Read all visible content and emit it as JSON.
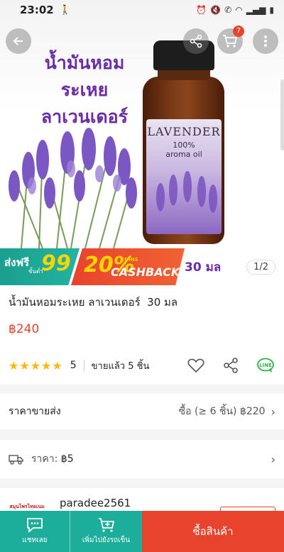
{
  "status_bar": {
    "time": "23:02",
    "walk_icon": "walking-icon",
    "right_icons": [
      "alarm-icon",
      "mute-icon",
      "call-icon",
      "wifi-icon",
      "signal-icon",
      "battery-icon"
    ]
  },
  "hero": {
    "title_line1": "น้ำมันหอมระเหย",
    "title_line2": "ลาเวนเดอร์",
    "bottle_label_title": "LAVENDER",
    "bottle_label_sub1": "100%",
    "bottle_label_sub2": "aroma oil",
    "cart_count": "7"
  },
  "promo": {
    "free_shipping_label": "ส่งฟรี",
    "free_shipping_min": "ขั้นต่ำ",
    "free_shipping_amount": "99",
    "cashback_percent": "20%",
    "cashback_coins": "COINS",
    "cashback_text": "CASHBACK",
    "volume": "30 มล",
    "page_indicator": "1/2"
  },
  "product": {
    "title": "น้ำมันหอมระเหย ลาเวนเดอร์  30 มล",
    "price": "฿240",
    "stars": "★★★★★",
    "rating": "5",
    "sold": "ขายแล้ว 5 ชิ้น"
  },
  "wholesale": {
    "label": "ราคาขายส่ง",
    "value": "ซื้อ (≥ 6 ชิ้น) ฿220"
  },
  "shipping": {
    "label": "ราคา:",
    "price": "฿5"
  },
  "shop": {
    "name": "paradee2561",
    "logo_text": "สมุนไพรไทยเนม"
  },
  "bottom_bar": {
    "chat_label": "แชทเลย",
    "add_cart_label": "เพิ่มไปยังรถเข็น",
    "buy_label": "ซื้อสินค้า"
  },
  "colors": {
    "brand_orange": "#e8432d",
    "teal": "#1cae9a",
    "purple": "#6a2ca8",
    "star": "#ffb800"
  }
}
